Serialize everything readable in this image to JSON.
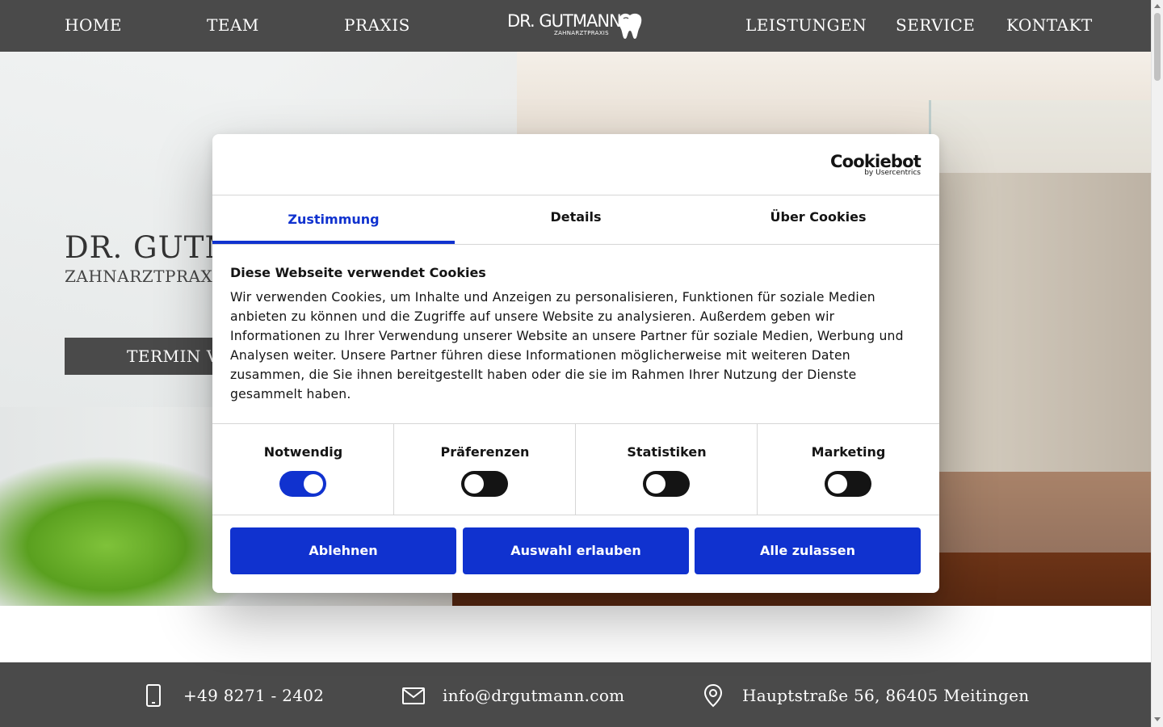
{
  "nav": {
    "left": [
      "HOME",
      "TEAM",
      "PRAXIS"
    ],
    "right": [
      "LEISTUNGEN",
      "SERVICE",
      "KONTAKT"
    ],
    "logo": {
      "name": "DR. GUTMANN",
      "sub": "ZAHNARZTPRAXIS"
    }
  },
  "hero": {
    "title": "DR. GUTM",
    "subtitle": "ZAHNARZTPRAXI",
    "cta": "TERMIN V"
  },
  "contact": {
    "phone": "+49 8271 - 2402",
    "email": "info@drgutmann.com",
    "address": "Hauptstraße 56, 86405 Meitingen"
  },
  "cookie_dialog": {
    "brand": {
      "name": "Cookiebot",
      "by": "by Usercentrics"
    },
    "tabs": [
      {
        "label": "Zustimmung",
        "active": true
      },
      {
        "label": "Details",
        "active": false
      },
      {
        "label": "Über Cookies",
        "active": false
      }
    ],
    "title": "Diese Webseite verwendet Cookies",
    "text": "Wir verwenden Cookies, um Inhalte und Anzeigen zu personalisieren, Funktionen für soziale Medien anbieten zu können und die Zugriffe auf unsere Website zu analysieren. Außerdem geben wir Informationen zu Ihrer Verwendung unserer Website an unsere Partner für soziale Medien, Werbung und Analysen weiter. Unsere Partner führen diese Informationen möglicherweise mit weiteren Daten zusammen, die Sie ihnen bereitgestellt haben oder die sie im Rahmen Ihrer Nutzung der Dienste gesammelt haben.",
    "categories": [
      {
        "label": "Notwendig",
        "enabled": true
      },
      {
        "label": "Präferenzen",
        "enabled": false
      },
      {
        "label": "Statistiken",
        "enabled": false
      },
      {
        "label": "Marketing",
        "enabled": false
      }
    ],
    "buttons": {
      "decline": "Ablehnen",
      "allow_selection": "Auswahl erlauben",
      "allow_all": "Alle zulassen"
    }
  },
  "colors": {
    "accent": "#1032cf",
    "nav_bg": "#4a4a4a",
    "text_dark": "#141414",
    "toggle_off": "#141414"
  },
  "icons": {
    "phone": "smartphone-icon",
    "email": "envelope-icon",
    "address": "map-pin-icon",
    "logo": "tooth-icon"
  }
}
